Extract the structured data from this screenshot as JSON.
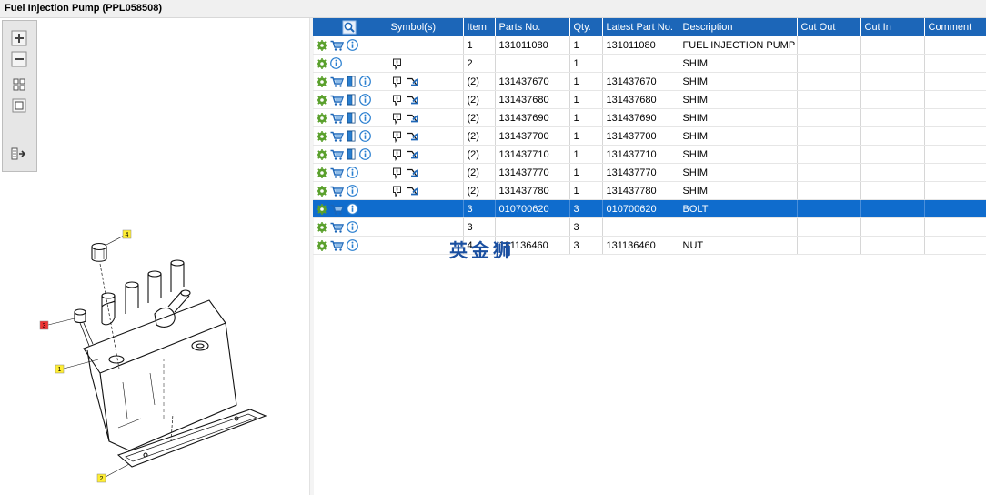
{
  "window": {
    "title": "Fuel Injection Pump (PPL058508)"
  },
  "columns": [
    "",
    "Symbol(s)",
    "Item",
    "Parts No.",
    "Qty.",
    "Latest Part No.",
    "Description",
    "Cut Out",
    "Cut In",
    "Comment"
  ],
  "rows": [
    {
      "item": "1",
      "parts_no": "131011080",
      "qty": "1",
      "latest": "131011080",
      "desc": "FUEL INJECTION PUMP",
      "cart": true,
      "book": false,
      "sym": false,
      "selected": false
    },
    {
      "item": "2",
      "parts_no": "",
      "qty": "1",
      "latest": "",
      "desc": "SHIM",
      "cart": false,
      "book": false,
      "sym": "pin",
      "selected": false
    },
    {
      "item": "(2)",
      "parts_no": "131437670",
      "qty": "1",
      "latest": "131437670",
      "desc": "SHIM",
      "cart": true,
      "book": true,
      "sym": "both",
      "selected": false
    },
    {
      "item": "(2)",
      "parts_no": "131437680",
      "qty": "1",
      "latest": "131437680",
      "desc": "SHIM",
      "cart": true,
      "book": true,
      "sym": "both",
      "selected": false
    },
    {
      "item": "(2)",
      "parts_no": "131437690",
      "qty": "1",
      "latest": "131437690",
      "desc": "SHIM",
      "cart": true,
      "book": true,
      "sym": "both",
      "selected": false
    },
    {
      "item": "(2)",
      "parts_no": "131437700",
      "qty": "1",
      "latest": "131437700",
      "desc": "SHIM",
      "cart": true,
      "book": true,
      "sym": "both",
      "selected": false
    },
    {
      "item": "(2)",
      "parts_no": "131437710",
      "qty": "1",
      "latest": "131437710",
      "desc": "SHIM",
      "cart": true,
      "book": true,
      "sym": "both",
      "selected": false
    },
    {
      "item": "(2)",
      "parts_no": "131437770",
      "qty": "1",
      "latest": "131437770",
      "desc": "SHIM",
      "cart": true,
      "book": false,
      "sym": "both",
      "selected": false
    },
    {
      "item": "(2)",
      "parts_no": "131437780",
      "qty": "1",
      "latest": "131437780",
      "desc": "SHIM",
      "cart": true,
      "book": false,
      "sym": "both",
      "selected": false
    },
    {
      "item": "3",
      "parts_no": "010700620",
      "qty": "3",
      "latest": "010700620",
      "desc": "BOLT",
      "cart": true,
      "book": false,
      "sym": false,
      "selected": true
    },
    {
      "item": "3",
      "parts_no": "",
      "qty": "3",
      "latest": "",
      "desc": "",
      "cart": true,
      "book": false,
      "sym": false,
      "selected": false
    },
    {
      "item": "4",
      "parts_no": "131136460",
      "qty": "3",
      "latest": "131136460",
      "desc": "NUT",
      "cart": true,
      "book": false,
      "sym": false,
      "selected": false
    }
  ],
  "watermark": "英金狮",
  "callouts": [
    "4",
    "3",
    "1",
    "2"
  ],
  "colors": {
    "header": "#1c66b8",
    "selected": "#0f6ccd",
    "callout_yellow": "#ffee33",
    "callout_red": "#ee3333"
  },
  "toolbar_icons": [
    "zoom-in-icon",
    "zoom-out-icon",
    "fit-view-icon",
    "actual-size-icon",
    "panel-toggle-icon"
  ]
}
